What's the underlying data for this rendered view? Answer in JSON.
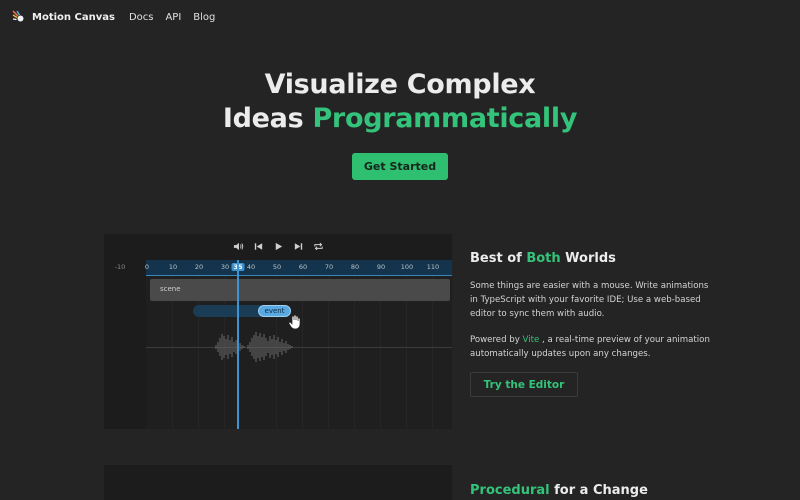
{
  "nav": {
    "brand": "Motion Canvas",
    "links": [
      "Docs",
      "API",
      "Blog"
    ]
  },
  "hero": {
    "line1": "Visualize Complex",
    "line2_plain": "Ideas ",
    "line2_accent": "Programmatically",
    "cta": "Get Started"
  },
  "editor": {
    "controls": [
      "volume-icon",
      "skip-back-icon",
      "play-icon",
      "skip-forward-icon",
      "loop-icon"
    ],
    "ruler_ticks": [
      "-10",
      "0",
      "10",
      "20",
      "30",
      "35",
      "40",
      "50",
      "60",
      "70",
      "80",
      "90",
      "100",
      "110"
    ],
    "current_frame": "35",
    "scene_label": "scene",
    "event_label": "event"
  },
  "feature1": {
    "heading_pre": "Best of ",
    "heading_accent": "Both",
    "heading_post": " Worlds",
    "p1": "Some things are easier with a mouse. Write animations in TypeScript with your favorite IDE; Use a web-based editor to sync them with audio.",
    "p2_pre": "Powered by ",
    "p2_link": "Vite",
    "p2_post": " , a real-time preview of your animation automatically updates upon any changes.",
    "button": "Try the Editor"
  },
  "feature2": {
    "heading_accent": "Procedural",
    "heading_post": " for a Change"
  },
  "colors": {
    "background": "#242424",
    "accent": "#33c37a",
    "timeline_blue": "#3d94d3"
  }
}
